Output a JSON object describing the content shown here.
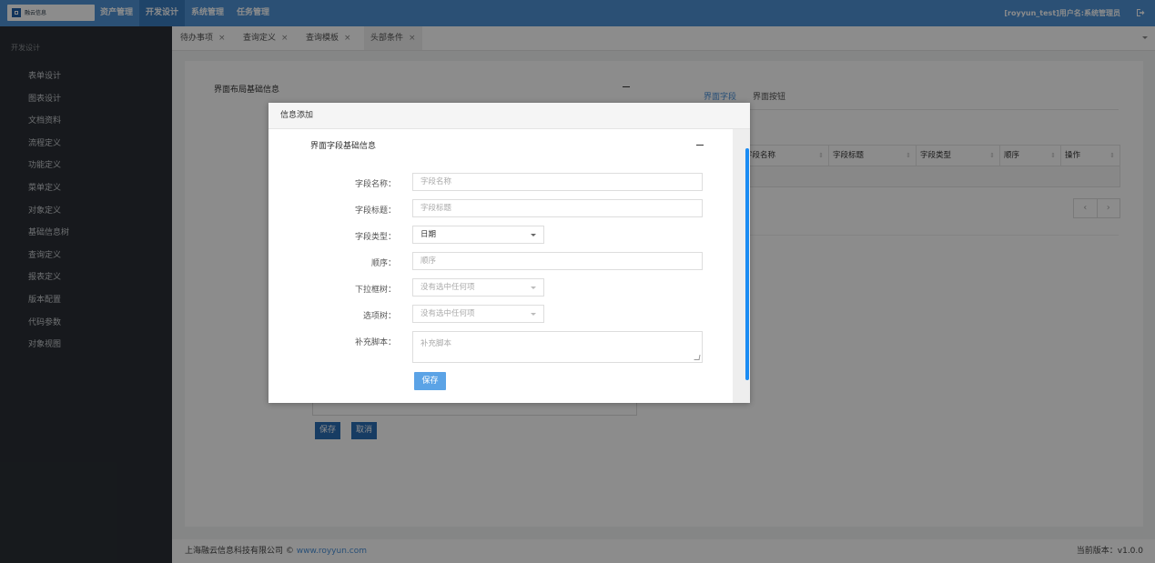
{
  "topbar": {
    "logo_text": "融云信息",
    "nav": [
      "资产管理",
      "开发设计",
      "系统管理",
      "任务管理"
    ],
    "active_nav": "开发设计",
    "user_text": "[royyun_test]用户名:系统管理员"
  },
  "sidebar": {
    "title": "开发设计",
    "items": [
      "表单设计",
      "图表设计",
      "文档资料",
      "流程定义",
      "功能定义",
      "菜单定义",
      "对象定义",
      "基础信息树",
      "查询定义",
      "报表定义",
      "版本配置",
      "代码参数",
      "对象视图"
    ]
  },
  "tabs": [
    {
      "label": "待办事项",
      "close": "×"
    },
    {
      "label": "查询定义",
      "close": "×"
    },
    {
      "label": "查询模板",
      "close": "×"
    },
    {
      "label": "头部条件",
      "close": "×"
    }
  ],
  "background_panel": {
    "section_title": "界面布局基础信息",
    "right_tabs": [
      "界面字段",
      "界面按钮"
    ],
    "table_headers": [
      "字段名称",
      "字段标题",
      "字段类型",
      "顺序",
      "操作"
    ],
    "pager": [
      "‹",
      "›"
    ],
    "buttons": [
      "保存",
      "取消"
    ]
  },
  "modal": {
    "title": "信息添加",
    "section_title": "界面字段基础信息",
    "fields": [
      {
        "label": "字段名称：",
        "placeholder": "字段名称"
      },
      {
        "label": "字段标题：",
        "placeholder": "字段标题"
      },
      {
        "label": "字段类型：",
        "value": "日期"
      },
      {
        "label": "顺序：",
        "placeholder": "顺序"
      },
      {
        "label": "下拉框树：",
        "placeholder": "没有选中任何项"
      },
      {
        "label": "选项树：",
        "placeholder": "没有选中任何项"
      },
      {
        "label": "补充脚本：",
        "placeholder": "补充脚本"
      }
    ],
    "save_label": "保存"
  },
  "footer": {
    "company": "上海融云信息科技有限公司 © ",
    "link": "www.royyun.com",
    "version": "当前版本：v1.0.0"
  },
  "colors": {
    "topbar": "#4f93d6",
    "sidebar": "#2a2f35",
    "accent": "#4a90d9",
    "scrollbar": "#1b8cf3"
  }
}
